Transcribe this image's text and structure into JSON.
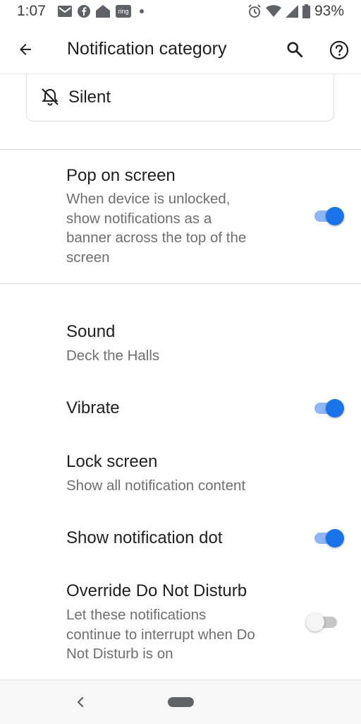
{
  "status_bar": {
    "time": "1:07",
    "left_icons": [
      "gmail-icon",
      "facebook-icon",
      "home-icon",
      "ring-icon",
      "dot-icon"
    ],
    "ring_text": "ring",
    "right_icons": [
      "alarm-icon",
      "wifi-icon",
      "signal-icon",
      "battery-icon"
    ],
    "battery": "93%"
  },
  "app_bar": {
    "title": "Notification category",
    "back_icon": "back-arrow-icon",
    "search_icon": "search-icon",
    "help_icon": "help-icon"
  },
  "silent": {
    "label": "Silent",
    "icon": "bell-off-icon"
  },
  "settings": {
    "pop_on_screen": {
      "title": "Pop on screen",
      "subtitle_lines": [
        "When device is unlocked,",
        "show notifications as a",
        "banner across the top of the",
        "screen"
      ],
      "enabled": true
    },
    "sound": {
      "title": "Sound",
      "value": "Deck the Halls"
    },
    "vibrate": {
      "title": "Vibrate",
      "enabled": true
    },
    "lock_screen": {
      "title": "Lock screen",
      "value": "Show all notification content"
    },
    "notification_dot": {
      "title": "Show notification dot",
      "enabled": true
    },
    "override_dnd": {
      "title": "Override Do Not Disturb",
      "subtitle_lines": [
        "Let these notifications",
        "continue to interrupt when Do",
        "Not Disturb is on"
      ],
      "enabled": false
    }
  },
  "nav_bar": {
    "back_icon": "nav-back-icon",
    "home_icon": "home-pill-icon"
  },
  "colors": {
    "accent": "#1a73e8",
    "accent_track": "#8fb6f3",
    "text_primary": "#202124",
    "text_secondary": "#6d6f72"
  }
}
